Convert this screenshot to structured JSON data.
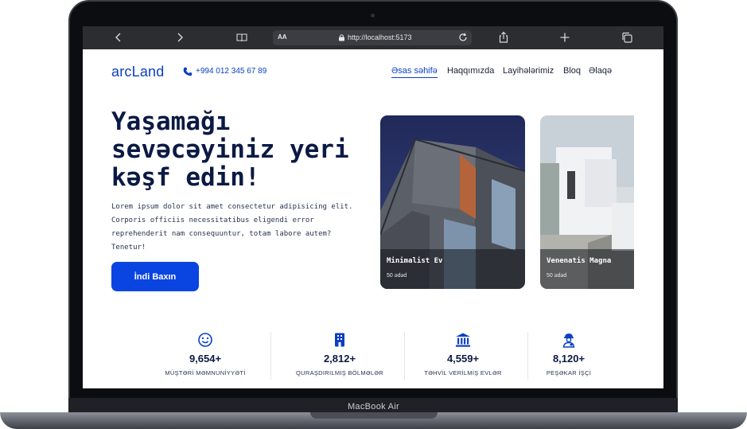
{
  "device": {
    "model_label": "MacBook Air"
  },
  "browser": {
    "url_text_size": "AA",
    "url": "http://localhost:5173"
  },
  "site": {
    "logo": "arcLand",
    "phone": "+994 012 345 67 89",
    "nav": [
      "Əsas səhifə",
      "Haqqımızda",
      "Layihələrimiz",
      "Bloq",
      "Əlaqə"
    ],
    "active_nav": 0
  },
  "hero": {
    "title": "Yaşamağı sevəcəyiniz yeri kəşf edin!",
    "text": "Lorem ipsum dolor sit amet consectetur adipisicing elit. Corporis officiis necessitatibus eligendi error reprehenderit nam consequuntur, totam labore autem? Tenetur!",
    "cta_label": "İndi Baxın"
  },
  "cards": [
    {
      "title": "Minimalist Ev",
      "subtitle": "50 ədəd"
    },
    {
      "title": "Venenatis Magna",
      "subtitle": "50 ədəd"
    }
  ],
  "stats": [
    {
      "icon": "smile-icon",
      "value": "9,654+",
      "label": "MÜŞTƏRİ MƏMNUNİYYƏTİ"
    },
    {
      "icon": "building-icon",
      "value": "2,812+",
      "label": "QURAŞDIRILMIŞ BÖLMƏLƏR"
    },
    {
      "icon": "bank-icon",
      "value": "4,559+",
      "label": "TƏHVİL VERİLMİŞ EVLƏR"
    },
    {
      "icon": "worker-icon",
      "value": "8,120+",
      "label": "PEŞƏKAR İŞÇİ"
    }
  ],
  "colors": {
    "brand": "#0b3fc4",
    "cta": "#0a45e2",
    "heading": "#0b1a44"
  }
}
